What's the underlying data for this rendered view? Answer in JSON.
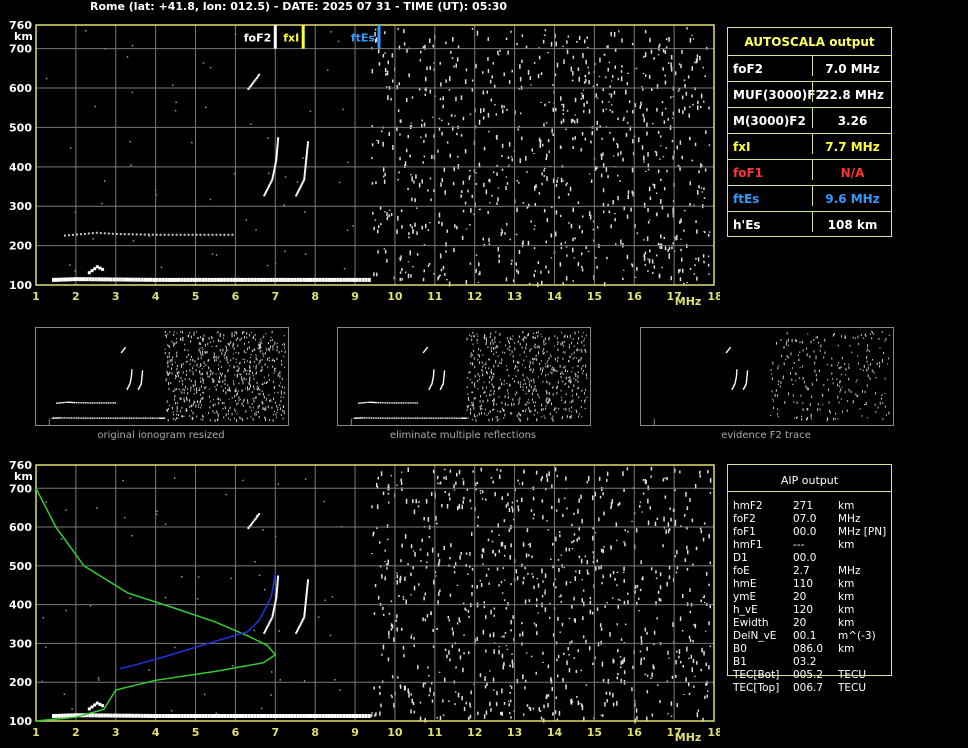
{
  "header": {
    "title": "Rome (lat: +41.8, lon: 012.5) - DATE: 2025 07 31 - TIME (UT): 05:30"
  },
  "colors": {
    "axis": "#e0e070",
    "grid": "#7a7a7a",
    "trace": "#ffffff",
    "fxI": "#ffff33",
    "ftEs": "#3399ff",
    "foF1": "#ff3333",
    "profile": "#33cc33",
    "fit": "#2233dd"
  },
  "chart_data": [
    {
      "type": "scatter",
      "name": "main-ionogram",
      "xlabel": "MHz",
      "ylabel": "km",
      "xlim": [
        1,
        18
      ],
      "ylim": [
        100,
        760
      ],
      "xticks": [
        "1",
        "2",
        "3",
        "4",
        "5",
        "6",
        "7",
        "8",
        "9",
        "10",
        "11",
        "12",
        "13",
        "14",
        "15",
        "16",
        "17",
        "18"
      ],
      "yticks": [
        "100",
        "200",
        "300",
        "400",
        "500",
        "600",
        "700",
        "760"
      ],
      "grid": true,
      "markers": [
        {
          "label": "foF2",
          "freq": 7.0,
          "color": "#ffffff"
        },
        {
          "label": "fxI",
          "freq": 7.7,
          "color": "#ffff33"
        },
        {
          "label": "ftEs",
          "freq": 9.6,
          "color": "#3399ff"
        }
      ],
      "traces": {
        "Es": [
          [
            1.4,
            118
          ],
          [
            2,
            120
          ],
          [
            3,
            119
          ],
          [
            4,
            118
          ],
          [
            5,
            118
          ],
          [
            6,
            118
          ],
          [
            7,
            118
          ],
          [
            8,
            118
          ],
          [
            9,
            118
          ],
          [
            9.4,
            118
          ]
        ],
        "Es_bump": [
          [
            2.3,
            135
          ],
          [
            2.5,
            150
          ],
          [
            2.7,
            140
          ]
        ],
        "Es_second": [
          [
            1.7,
            228
          ],
          [
            2.5,
            235
          ],
          [
            3,
            232
          ],
          [
            4,
            230
          ],
          [
            5,
            230
          ],
          [
            6,
            230
          ]
        ],
        "F2_o": [
          [
            6.7,
            330
          ],
          [
            6.9,
            370
          ],
          [
            7.0,
            420
          ],
          [
            7.05,
            480
          ]
        ],
        "F2_x": [
          [
            7.5,
            330
          ],
          [
            7.7,
            370
          ],
          [
            7.75,
            420
          ],
          [
            7.8,
            470
          ]
        ],
        "F2_multiple": [
          [
            6.3,
            600
          ],
          [
            6.6,
            640
          ]
        ]
      },
      "noise_start_freq": 9.4
    },
    {
      "type": "scatter",
      "name": "aip-ionogram",
      "xlabel": "MHz",
      "ylabel": "km",
      "xlim": [
        1,
        18
      ],
      "ylim": [
        100,
        760
      ],
      "xticks": [
        "1",
        "2",
        "3",
        "4",
        "5",
        "6",
        "7",
        "8",
        "9",
        "10",
        "11",
        "12",
        "13",
        "14",
        "15",
        "16",
        "17",
        "18"
      ],
      "yticks": [
        "100",
        "200",
        "300",
        "400",
        "500",
        "600",
        "700",
        "760"
      ],
      "grid": true,
      "profile": [
        [
          1.0,
          700
        ],
        [
          1.5,
          600
        ],
        [
          2.2,
          500
        ],
        [
          3.3,
          430
        ],
        [
          4.5,
          390
        ],
        [
          5.5,
          355
        ],
        [
          6.3,
          320
        ],
        [
          6.8,
          295
        ],
        [
          7.0,
          271
        ],
        [
          6.7,
          250
        ],
        [
          5.5,
          228
        ],
        [
          4.0,
          205
        ],
        [
          3.0,
          180
        ],
        [
          2.7,
          130
        ],
        [
          2.0,
          110
        ],
        [
          1.0,
          100
        ]
      ],
      "fit": [
        [
          3.1,
          235
        ],
        [
          3.5,
          245
        ],
        [
          4.2,
          265
        ],
        [
          5.0,
          290
        ],
        [
          5.8,
          315
        ],
        [
          6.3,
          330
        ],
        [
          6.6,
          360
        ],
        [
          6.9,
          420
        ],
        [
          7.0,
          480
        ]
      ]
    }
  ],
  "autoscala": {
    "title": "AUTOSCALA output",
    "rows": [
      {
        "label": "foF2",
        "value": "7.0 MHz",
        "color": "#ffffff"
      },
      {
        "label": "MUF(3000)F2",
        "value": "22.8 MHz",
        "color": "#ffffff"
      },
      {
        "label": "M(3000)F2",
        "value": "3.26",
        "color": "#ffffff"
      },
      {
        "label": "fxI",
        "value": "7.7 MHz",
        "color": "#ffff33"
      },
      {
        "label": "foF1",
        "value": "N/A",
        "color": "#ff3333"
      },
      {
        "label": "ftEs",
        "value": "9.6 MHz",
        "color": "#3399ff"
      },
      {
        "label": "h'Es",
        "value": "108    km",
        "color": "#ffffff"
      }
    ]
  },
  "captions": {
    "thumb1": "original ionogram resized",
    "thumb2": "eliminate multiple reflections",
    "thumb3": "evidence F2 trace"
  },
  "aip": {
    "title": "AIP output",
    "rows": [
      {
        "name": "hmF2",
        "value": "271",
        "unit": "km"
      },
      {
        "name": "foF2",
        "value": "07.0",
        "unit": "MHz"
      },
      {
        "name": "foF1",
        "value": "00.0",
        "unit": "MHz    [PN]"
      },
      {
        "name": "hmF1",
        "value": "---",
        "unit": "km"
      },
      {
        "name": "D1",
        "value": "00.0",
        "unit": ""
      },
      {
        "name": "foE",
        "value": "2.7",
        "unit": "MHz"
      },
      {
        "name": "hmE",
        "value": "110",
        "unit": "km"
      },
      {
        "name": "ymE",
        "value": "20",
        "unit": "km"
      },
      {
        "name": "h_vE",
        "value": "120",
        "unit": "km"
      },
      {
        "name": "Ewidth",
        "value": "20",
        "unit": "km"
      },
      {
        "name": "DelN_vE",
        "value": "00.1",
        "unit": "m^(-3)"
      },
      {
        "name": "B0",
        "value": "086.0",
        "unit": "km"
      },
      {
        "name": "B1",
        "value": "03.2",
        "unit": ""
      },
      {
        "name": "TEC[Bot]",
        "value": "005.2",
        "unit": "TECU"
      },
      {
        "name": "TEC[Top]",
        "value": "006.7",
        "unit": "TECU"
      }
    ]
  }
}
